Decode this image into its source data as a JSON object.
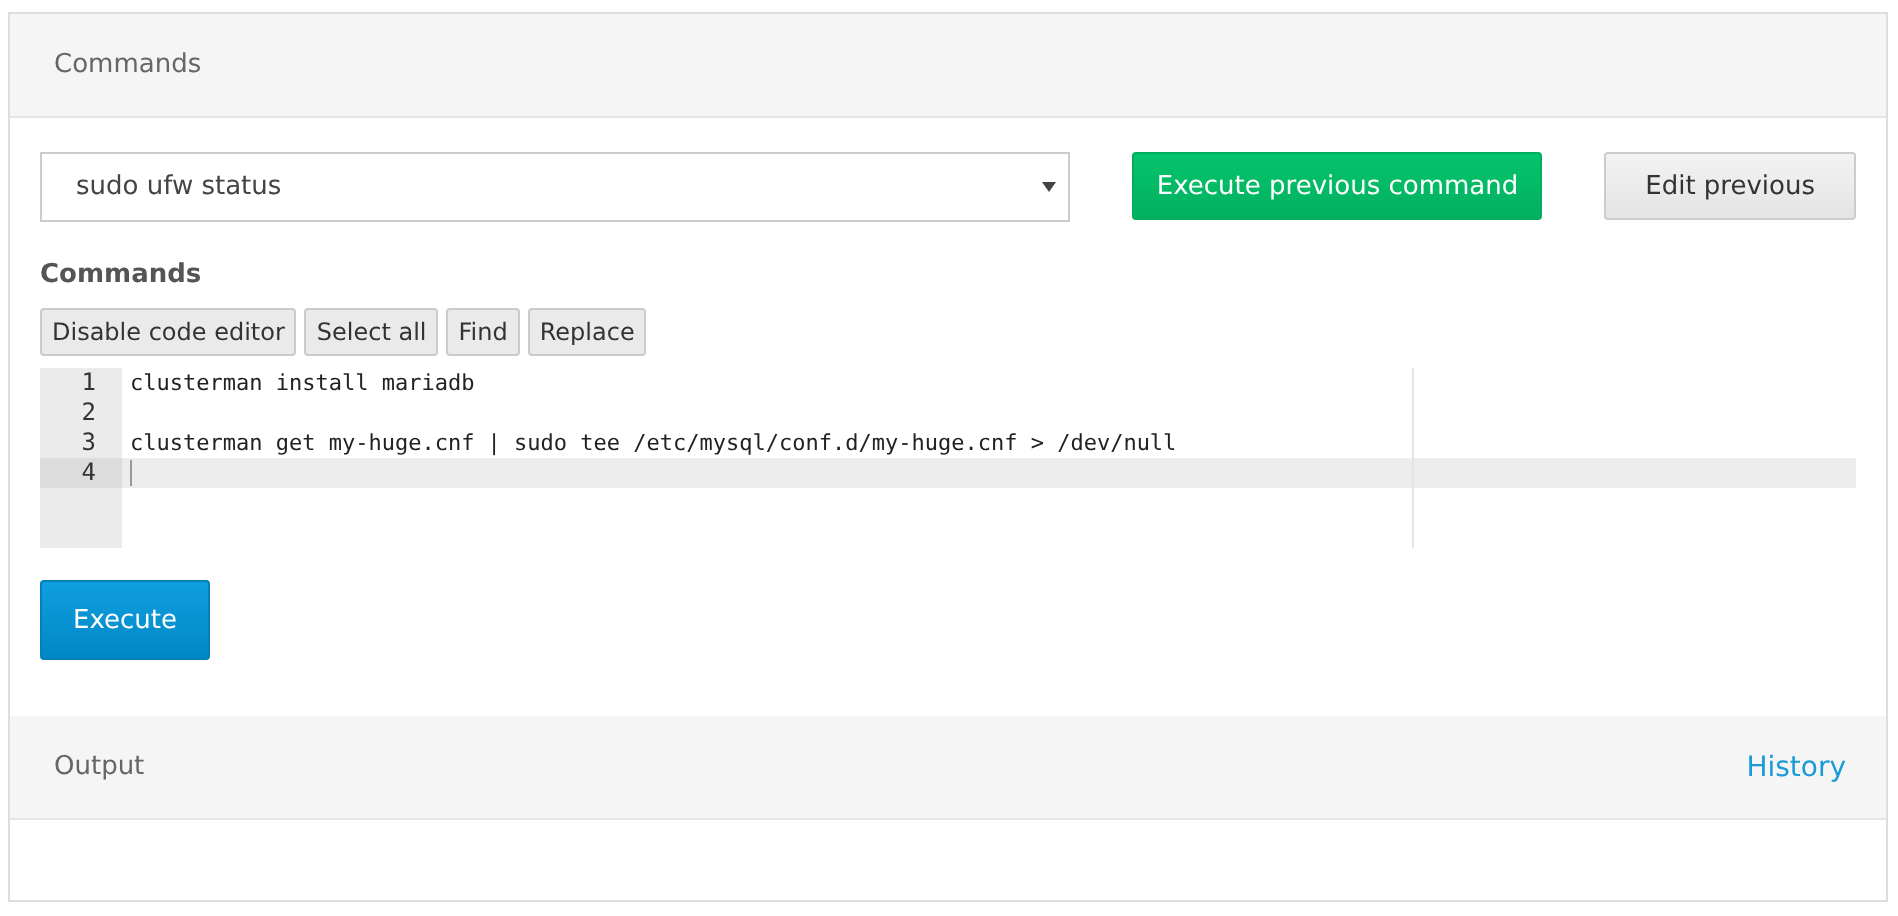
{
  "commands_panel": {
    "title": "Commands"
  },
  "command_select": {
    "value": "sudo ufw status"
  },
  "buttons": [
    {
      "label": "Execute previous command",
      "kind": "primary"
    },
    {
      "label": "Edit previous",
      "kind": "default"
    }
  ],
  "editor_label": "Commands",
  "editor_toolbar": [
    "Disable code editor",
    "Select all",
    "Find",
    "Replace"
  ],
  "editor_lines": [
    {
      "number": "1",
      "text": "clusterman install mariadb",
      "active": false
    },
    {
      "number": "2",
      "active": false
    },
    {
      "number": "3",
      "text": "clusterman get my-huge.cnf | sudo tee /etc/mysql/conf.d/my-huge.cnf > /dev/null",
      "active": false
    },
    {
      "number": "4",
      "active": true
    }
  ],
  "execute_button": "Execute",
  "output_panel": {
    "title": "Output",
    "link": "History"
  }
}
